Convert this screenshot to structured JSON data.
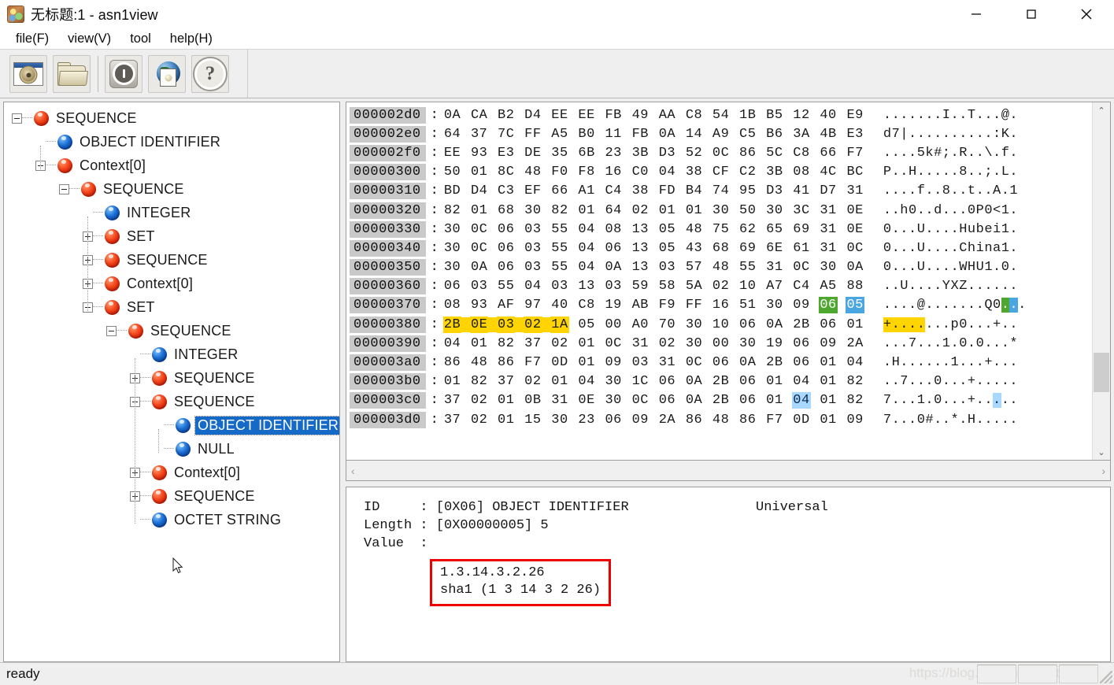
{
  "window": {
    "title": "无标题:1 - asn1view",
    "icon": "app-icon",
    "minimize_label": "—",
    "maximize_label": "□",
    "close_label": "✕"
  },
  "menubar": {
    "items": [
      {
        "label": "file(F)"
      },
      {
        "label": "view(V)"
      },
      {
        "label": "tool"
      },
      {
        "label": "help(H)"
      }
    ]
  },
  "toolbar": {
    "buttons": [
      {
        "name": "new-document-button",
        "icon": "new-document-icon"
      },
      {
        "name": "open-folder-button",
        "icon": "open-folder-icon"
      },
      {
        "name": "info-button",
        "icon": "info-circle-icon"
      },
      {
        "name": "globe-button",
        "icon": "globe-picture-icon"
      },
      {
        "name": "help-button",
        "icon": "question-mark-icon",
        "glyph": "?"
      }
    ]
  },
  "tree": {
    "nodes": [
      {
        "label": "SEQUENCE",
        "depth": 0,
        "expander": "minus",
        "ball": "red",
        "selected": false
      },
      {
        "label": "OBJECT IDENTIFIER",
        "depth": 1,
        "expander": "none",
        "ball": "blue",
        "selected": false
      },
      {
        "label": "Context[0]",
        "depth": 1,
        "expander": "minus",
        "ball": "red",
        "selected": false
      },
      {
        "label": "SEQUENCE",
        "depth": 2,
        "expander": "minus",
        "ball": "red",
        "selected": false
      },
      {
        "label": "INTEGER",
        "depth": 3,
        "expander": "none",
        "ball": "blue",
        "selected": false
      },
      {
        "label": "SET",
        "depth": 3,
        "expander": "plus",
        "ball": "red",
        "selected": false
      },
      {
        "label": "SEQUENCE",
        "depth": 3,
        "expander": "plus",
        "ball": "red",
        "selected": false
      },
      {
        "label": "Context[0]",
        "depth": 3,
        "expander": "plus",
        "ball": "red",
        "selected": false
      },
      {
        "label": "SET",
        "depth": 3,
        "expander": "minus",
        "ball": "red",
        "selected": false
      },
      {
        "label": "SEQUENCE",
        "depth": 4,
        "expander": "minus",
        "ball": "red",
        "selected": false
      },
      {
        "label": "INTEGER",
        "depth": 5,
        "expander": "none",
        "ball": "blue",
        "selected": false
      },
      {
        "label": "SEQUENCE",
        "depth": 5,
        "expander": "plus",
        "ball": "red",
        "selected": false
      },
      {
        "label": "SEQUENCE",
        "depth": 5,
        "expander": "minus",
        "ball": "red",
        "selected": false
      },
      {
        "label": "OBJECT IDENTIFIER",
        "depth": 6,
        "expander": "none",
        "ball": "blue",
        "selected": true
      },
      {
        "label": "NULL",
        "depth": 6,
        "expander": "none",
        "ball": "blue",
        "selected": false
      },
      {
        "label": "Context[0]",
        "depth": 5,
        "expander": "plus",
        "ball": "red",
        "selected": false
      },
      {
        "label": "SEQUENCE",
        "depth": 5,
        "expander": "plus",
        "ball": "red",
        "selected": false
      },
      {
        "label": "OCTET STRING",
        "depth": 5,
        "expander": "none",
        "ball": "blue",
        "selected": false
      }
    ]
  },
  "hexview": {
    "rows": [
      {
        "offset": "000002d0",
        "bytes": "0A CA B2 D4 EE EE FB 49 AA C8 54 1B B5 12 40 E9",
        "ascii": ".......I..T...@."
      },
      {
        "offset": "000002e0",
        "bytes": "64 37 7C FF A5 B0 11 FB 0A 14 A9 C5 B6 3A 4B E3",
        "ascii": "d7|..........:K."
      },
      {
        "offset": "000002f0",
        "bytes": "EE 93 E3 DE 35 6B 23 3B D3 52 0C 86 5C C8 66 F7",
        "ascii": "....5k#;.R..\\.f."
      },
      {
        "offset": "00000300",
        "bytes": "50 01 8C 48 F0 F8 16 C0 04 38 CF C2 3B 08 4C BC",
        "ascii": "P..H.....8..;.L."
      },
      {
        "offset": "00000310",
        "bytes": "BD D4 C3 EF 66 A1 C4 38 FD B4 74 95 D3 41 D7 31",
        "ascii": "....f..8..t..A.1"
      },
      {
        "offset": "00000320",
        "bytes": "82 01 68 30 82 01 64 02 01 01 30 50 30 3C 31 0E",
        "ascii": "..h0..d...0P0<1."
      },
      {
        "offset": "00000330",
        "bytes": "30 0C 06 03 55 04 08 13 05 48 75 62 65 69 31 0E",
        "ascii": "0...U....Hubei1."
      },
      {
        "offset": "00000340",
        "bytes": "30 0C 06 03 55 04 06 13 05 43 68 69 6E 61 31 0C",
        "ascii": "0...U....China1."
      },
      {
        "offset": "00000350",
        "bytes": "30 0A 06 03 55 04 0A 13 03 57 48 55 31 0C 30 0A",
        "ascii": "0...U....WHU1.0."
      },
      {
        "offset": "00000360",
        "bytes": "06 03 55 04 03 13 03 59 58 5A 02 10 A7 C4 A5 88",
        "ascii": "..U....YXZ......"
      },
      {
        "offset": "00000370",
        "bytes": "08 93 AF 97 40 C8 19 AB F9 FF 16 51 30 09 06 05",
        "ascii": "....@.......Q0..."
      },
      {
        "offset": "00000380",
        "bytes": "2B 0E 03 02 1A 05 00 A0 70 30 10 06 0A 2B 06 01",
        "ascii": "+.......p0...+.."
      },
      {
        "offset": "00000390",
        "bytes": "04 01 82 37 02 01 0C 31 02 30 00 30 19 06 09 2A",
        "ascii": "...7...1.0.0...*"
      },
      {
        "offset": "000003a0",
        "bytes": "86 48 86 F7 0D 01 09 03 31 0C 06 0A 2B 06 01 04",
        "ascii": ".H......1...+..."
      },
      {
        "offset": "000003b0",
        "bytes": "01 82 37 02 01 04 30 1C 06 0A 2B 06 01 04 01 82",
        "ascii": "..7...0...+....."
      },
      {
        "offset": "000003c0",
        "bytes": "37 02 01 0B 31 0E 30 0C 06 0A 2B 06 01 04 01 82",
        "ascii": "7...1.0...+....."
      },
      {
        "offset": "000003d0",
        "bytes": "37 02 01 15 30 23 06 09 2A 86 48 86 F7 0D 01 09",
        "ascii": "7...0#..*.H....."
      }
    ],
    "highlights": {
      "yellow_row": "00000380",
      "yellow_byte_range": [
        0,
        4
      ],
      "yellow_ascii_range": [
        0,
        4
      ],
      "green_row": "00000370",
      "green_byte_index": 14,
      "green_ascii_index": 14,
      "blue_row": "00000370",
      "blue_byte_index": 15,
      "blue_ascii_index": 15,
      "lightblue_row": "000003c0",
      "lightblue_byte_index": 13,
      "lightblue_ascii_index": 13
    },
    "scroll": {
      "up_arrow": "⌃",
      "down_arrow": "⌄",
      "left_arrow": "‹",
      "right_arrow": "›"
    }
  },
  "detail": {
    "id_line": "ID     : [0X06] OBJECT IDENTIFIER",
    "id_class": "Universal",
    "length_line": "Length : [0X00000005] 5",
    "value_line": "Value  :",
    "value_box": {
      "oid": "1.3.14.3.2.26",
      "name": "sha1 (1 3 14 3 2 26)",
      "border_color": "#ef0000"
    }
  },
  "statusbar": {
    "text": "ready",
    "watermark": "https://blog.csdn.net/Eastmount"
  },
  "colors": {
    "selection_blue": "#1569c7",
    "highlight_yellow": "#ffd400",
    "highlight_green": "#4ea72e",
    "highlight_blue": "#4aa6e0",
    "highlight_lightblue": "#a8d8ff",
    "offset_bg": "#c9c9c9",
    "chrome_bg": "#f0efef"
  }
}
